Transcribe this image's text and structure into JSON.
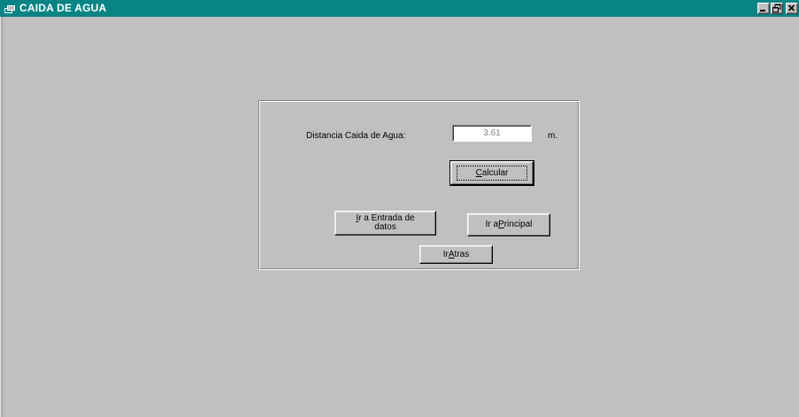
{
  "window": {
    "title": "CAIDA DE AGUA"
  },
  "form": {
    "distance_label": "Distancia Caida de Agua:",
    "distance_value": "3.61",
    "unit": "m.",
    "calcular": {
      "accel": "C",
      "rest": "alcular"
    },
    "entrada": {
      "accel": "I",
      "line1_rest": "r a Entrada de",
      "line2": "datos"
    },
    "principal": {
      "pre": "Ir a ",
      "accel": "P",
      "rest": "rincipal"
    },
    "atras": {
      "pre": "Ir ",
      "accel": "A",
      "rest": "tras"
    }
  },
  "colors": {
    "titlebar": "#088484",
    "face": "#c0c0c0"
  }
}
